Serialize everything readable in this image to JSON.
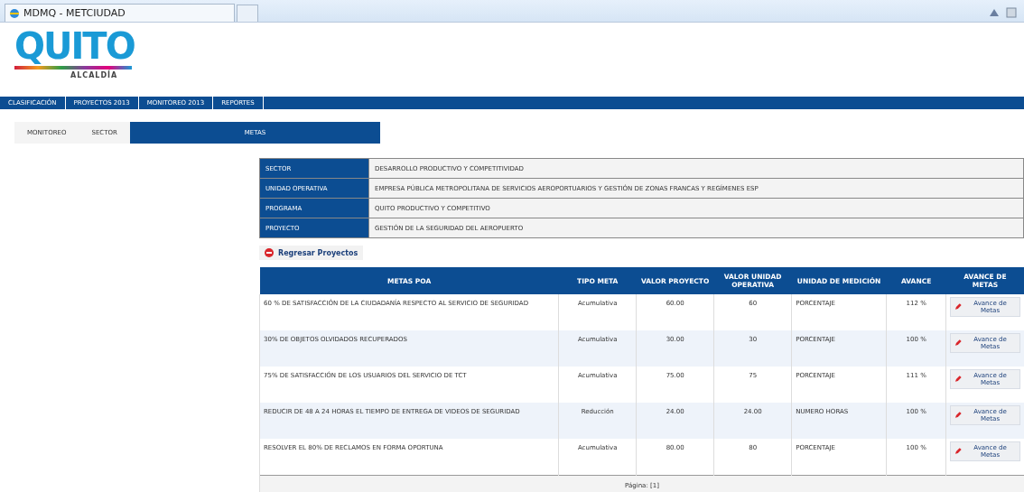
{
  "browser": {
    "tab_title": "MDMQ - METCIUDAD"
  },
  "logo": {
    "name": "QUITO",
    "subtitle": "ALCALDÍA"
  },
  "menu": [
    {
      "label": "CLASIFICACIÓN"
    },
    {
      "label": "PROYECTOS 2013"
    },
    {
      "label": "MONITOREO 2013"
    },
    {
      "label": "REPORTES"
    }
  ],
  "tabs": [
    {
      "label": "MONITOREO",
      "selected": false
    },
    {
      "label": "SECTOR",
      "selected": false
    },
    {
      "label": "METAS",
      "selected": true
    }
  ],
  "info": [
    {
      "label": "SECTOR",
      "value": "DESARROLLO PRODUCTIVO Y COMPETITIVIDAD"
    },
    {
      "label": "UNIDAD OPERATIVA",
      "value": "EMPRESA PÚBLICA METROPOLITANA DE SERVICIOS AEROPORTUARIOS Y GESTIÓN DE ZONAS FRANCAS Y REGÍMENES ESP"
    },
    {
      "label": "PROGRAMA",
      "value": "QUITO PRODUCTIVO Y COMPETITIVO"
    },
    {
      "label": "PROYECTO",
      "value": "GESTIÓN DE LA SEGURIDAD DEL AEROPUERTO"
    }
  ],
  "back_button": "Regresar Proyectos",
  "table": {
    "columns": [
      "METAS POA",
      "TIPO META",
      "VALOR PROYECTO",
      "VALOR UNIDAD OPERATIVA",
      "UNIDAD DE MEDICIÓN",
      "AVANCE",
      "AVANCE DE METAS"
    ],
    "rows": [
      {
        "meta": "60 % DE SATISFACCIÓN DE LA CIUDADANÍA RESPECTO AL SERVICIO DE SEGURIDAD",
        "tipo": "Acumulativa",
        "valor_proyecto": "60.00",
        "valor_unidad": "60",
        "unidad": "PORCENTAJE",
        "avance": "112 %",
        "action": "Avance de Metas"
      },
      {
        "meta": "30% DE OBJETOS OLVIDADOS RECUPERADOS",
        "tipo": "Acumulativa",
        "valor_proyecto": "30.00",
        "valor_unidad": "30",
        "unidad": "PORCENTAJE",
        "avance": "100 %",
        "action": "Avance de Metas"
      },
      {
        "meta": "75% DE SATISFACCIÓN DE LOS USUARIOS DEL SERVICIO DE TCT",
        "tipo": "Acumulativa",
        "valor_proyecto": "75.00",
        "valor_unidad": "75",
        "unidad": "PORCENTAJE",
        "avance": "111 %",
        "action": "Avance de Metas"
      },
      {
        "meta": "REDUCIR DE 48 A 24 HORAS EL TIEMPO DE ENTREGA DE VIDEOS DE SEGURIDAD",
        "tipo": "Reducción",
        "valor_proyecto": "24.00",
        "valor_unidad": "24.00",
        "unidad": "NUMERO HORAS",
        "avance": "100 %",
        "action": "Avance de Metas"
      },
      {
        "meta": "RESOLVER EL 80% DE RECLAMOS EN FORMA OPORTUNA",
        "tipo": "Acumulativa",
        "valor_proyecto": "80.00",
        "valor_unidad": "80",
        "unidad": "PORCENTAJE",
        "avance": "100 %",
        "action": "Avance de Metas"
      }
    ],
    "pager": "Página: [1]"
  }
}
